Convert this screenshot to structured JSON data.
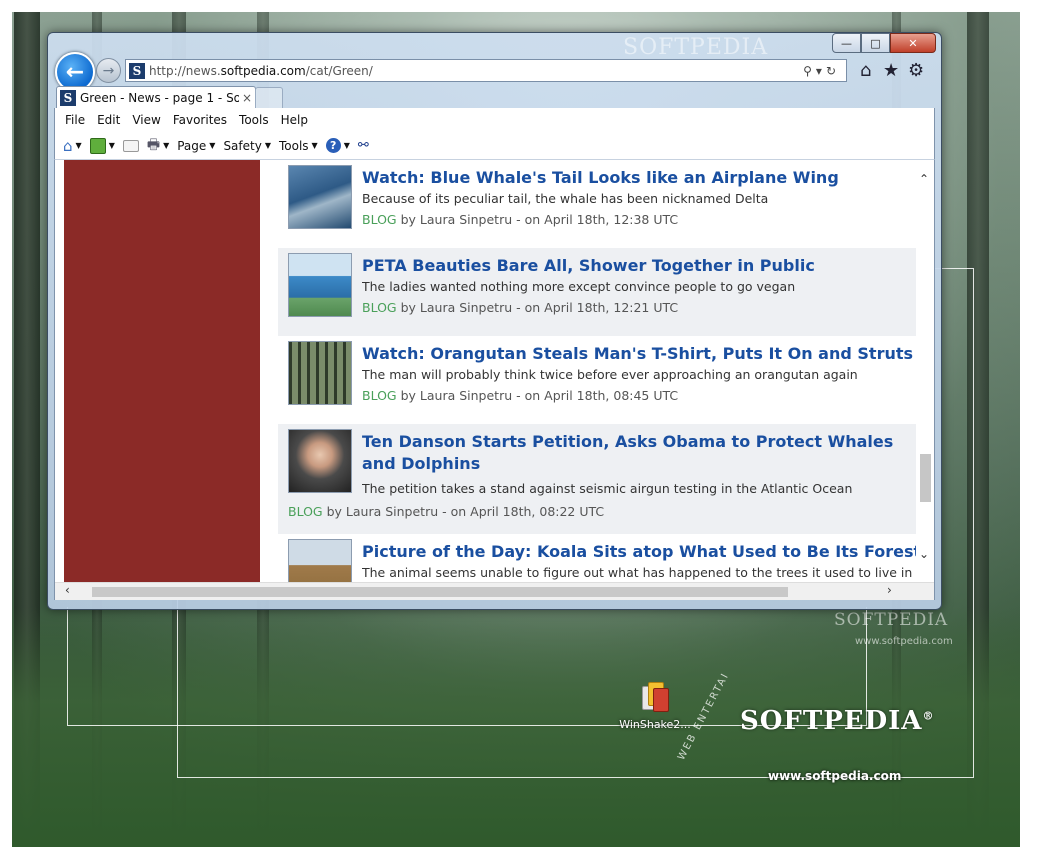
{
  "desktop": {
    "watermark_top": "SOFTPEDIA",
    "logo_text": "SOFTPEDIA",
    "logo_registered": "®",
    "url_text": "www.softpedia.com",
    "faint_logo": "SOFTPEDIA",
    "faint_url": "www.softpedia.com",
    "web_text": "WEB  ENTERTAI",
    "icon_label": "WinShake2..."
  },
  "browser": {
    "address_url_prefix": "http://news.",
    "address_url_domain": "softpedia.com",
    "address_url_path": "/cat/Green/",
    "address_tools": "P▾ C",
    "tab_title": "Green - News - page 1 - Sof...",
    "tab_close": "×",
    "caption": {
      "minimize": "—",
      "maximize": "□",
      "close": "✕"
    },
    "menu": [
      "File",
      "Edit",
      "View",
      "Favorites",
      "Tools",
      "Help"
    ],
    "commands": {
      "page": "Page",
      "safety": "Safety",
      "tools": "Tools"
    }
  },
  "articles": [
    {
      "title": "Watch: Blue Whale's Tail Looks like an Airplane Wing",
      "desc": "Because of its peculiar tail, the whale has been nicknamed Delta",
      "tag": "BLOG",
      "meta": " by Laura Sinpetru - on April 18th, 12:38 UTC"
    },
    {
      "title": "PETA Beauties Bare All, Shower Together in Public",
      "desc": "The ladies wanted nothing more except convince people to go vegan",
      "tag": "BLOG",
      "meta": " by Laura Sinpetru - on April 18th, 12:21 UTC"
    },
    {
      "title": "Watch: Orangutan Steals Man's T-Shirt, Puts It On and Struts Ar",
      "desc": "The man will probably think twice before ever approaching an orangutan again",
      "tag": "BLOG",
      "meta": " by Laura Sinpetru - on April 18th, 08:45 UTC"
    },
    {
      "title": "Ten Danson Starts Petition, Asks Obama to Protect Whales and Dolphins",
      "desc": "The petition takes a stand against seismic airgun testing in the Atlantic Ocean",
      "tag": "BLOG",
      "meta": " by Laura Sinpetru - on April 18th, 08:22 UTC"
    },
    {
      "title": "Picture of the Day: Koala Sits atop What Used to Be Its Forest H",
      "desc": "The animal seems unable to figure out what has happened to the trees it used to live in"
    }
  ]
}
